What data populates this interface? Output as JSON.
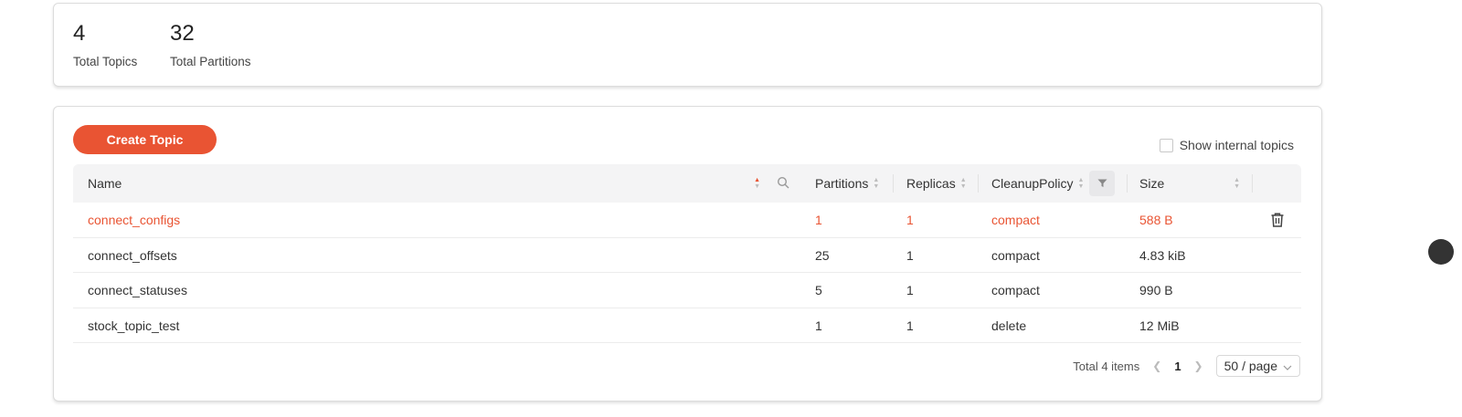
{
  "stats": {
    "topics_count": "4",
    "topics_label": "Total Topics",
    "partitions_count": "32",
    "partitions_label": "Total Partitions"
  },
  "toolbar": {
    "create_label": "Create Topic",
    "internal_label": "Show internal topics"
  },
  "table": {
    "columns": [
      "Name",
      "Partitions",
      "Replicas",
      "CleanupPolicy",
      "Size"
    ],
    "rows": [
      {
        "name": "connect_configs",
        "partitions": "1",
        "replicas": "1",
        "cleanup": "compact",
        "size": "588 B"
      },
      {
        "name": "connect_offsets",
        "partitions": "25",
        "replicas": "1",
        "cleanup": "compact",
        "size": "4.83 kiB"
      },
      {
        "name": "connect_statuses",
        "partitions": "5",
        "replicas": "1",
        "cleanup": "compact",
        "size": "990 B"
      },
      {
        "name": "stock_topic_test",
        "partitions": "1",
        "replicas": "1",
        "cleanup": "delete",
        "size": "12 MiB"
      }
    ]
  },
  "pagination": {
    "total": "Total 4 items",
    "current_page": "1",
    "page_size": "50 / page"
  },
  "colors": {
    "accent": "#e95433"
  },
  "icons": [
    "search-icon",
    "filter-icon",
    "trash-icon",
    "chevron-left-icon",
    "chevron-right-icon",
    "chevron-down-icon"
  ]
}
